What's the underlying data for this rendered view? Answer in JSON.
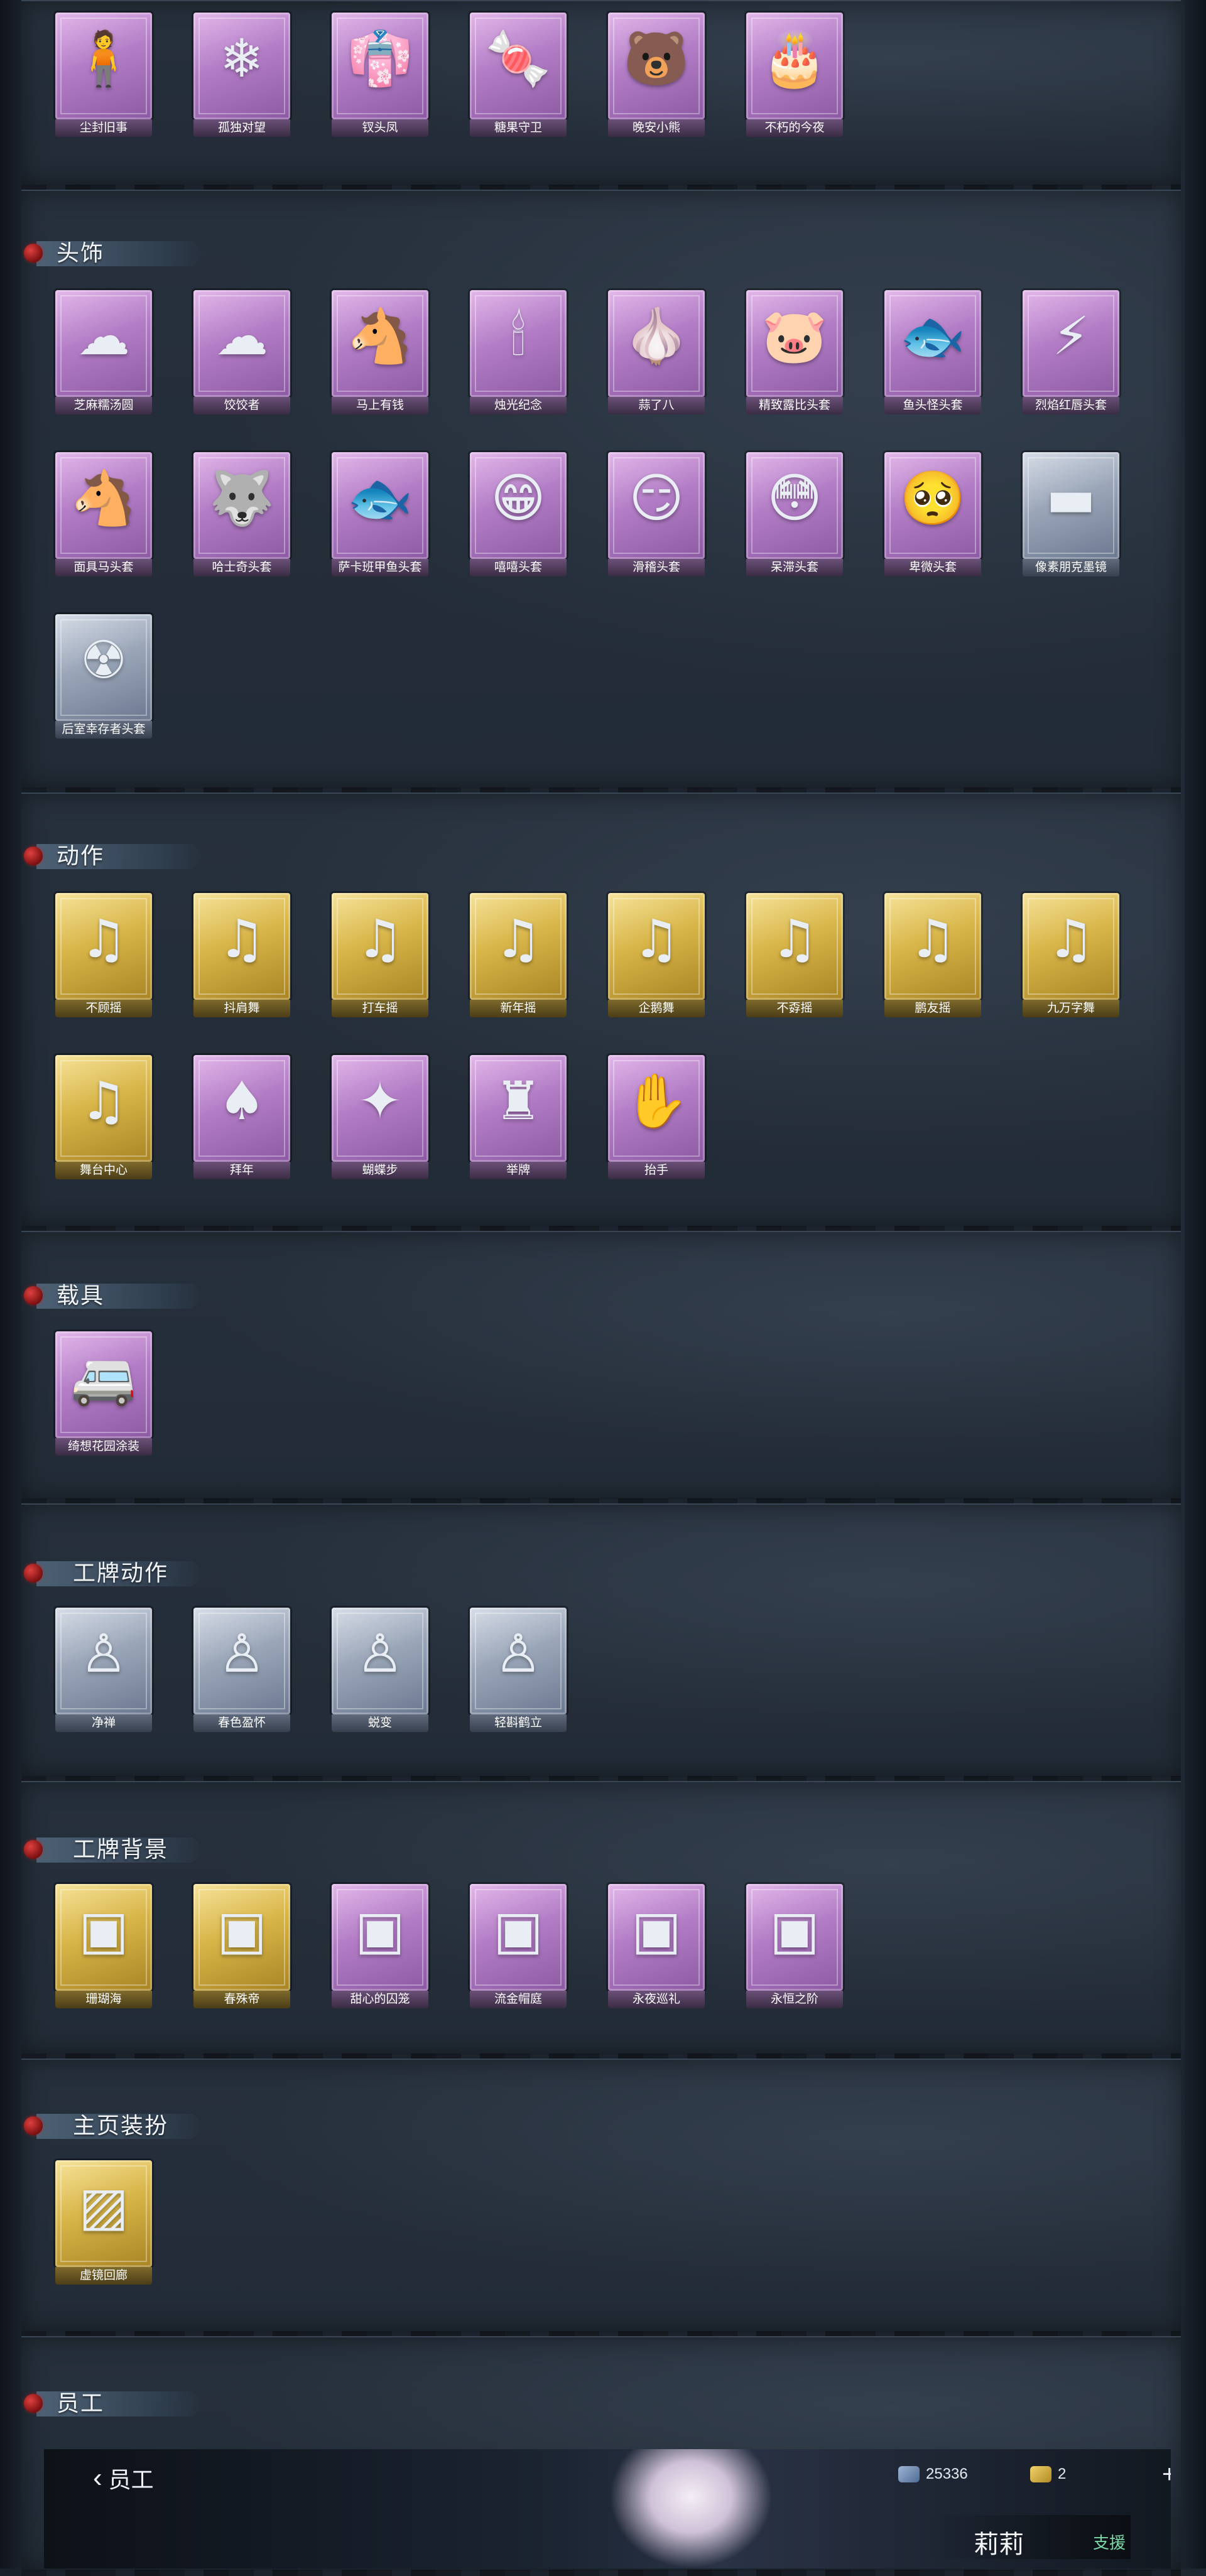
{
  "colors": {
    "panel": "#222b36",
    "rarity_purple": "#b37dc6",
    "rarity_gold": "#d8b548",
    "rarity_silver": "#9aa6b8",
    "header_dot": "#c02a2a"
  },
  "sections": [
    {
      "title": "",
      "items": [
        {
          "label": "尘封旧事",
          "rarity": "purple",
          "icon": "figure-keychain-icon"
        },
        {
          "label": "孤独对望",
          "rarity": "purple",
          "icon": "crystal-keychain-icon"
        },
        {
          "label": "钗头凤",
          "rarity": "purple",
          "icon": "doll-keychain-icon"
        },
        {
          "label": "糖果守卫",
          "rarity": "purple",
          "icon": "candy-guard-keychain-icon"
        },
        {
          "label": "晚安小熊",
          "rarity": "purple",
          "icon": "bear-keychain-icon"
        },
        {
          "label": "不朽的今夜",
          "rarity": "purple",
          "icon": "cake-keychain-icon"
        }
      ]
    },
    {
      "title": "头饰",
      "items": [
        {
          "label": "芝麻糯汤圆",
          "rarity": "purple",
          "icon": "dumpling-hat-icon"
        },
        {
          "label": "饺饺者",
          "rarity": "purple",
          "icon": "cloud-hat-icon"
        },
        {
          "label": "马上有钱",
          "rarity": "purple",
          "icon": "horse-hat-icon"
        },
        {
          "label": "烛光纪念",
          "rarity": "purple",
          "icon": "candle-hat-icon"
        },
        {
          "label": "蒜了八",
          "rarity": "purple",
          "icon": "garlic-hat-icon"
        },
        {
          "label": "精致露比头套",
          "rarity": "purple",
          "icon": "pink-mask-icon"
        },
        {
          "label": "鱼头怪头套",
          "rarity": "purple",
          "icon": "fish-head-icon"
        },
        {
          "label": "烈焰红唇头套",
          "rarity": "purple",
          "icon": "yellow-mascot-icon"
        },
        {
          "label": "面具马头套",
          "rarity": "purple",
          "icon": "horse-mask-icon"
        },
        {
          "label": "哈士奇头套",
          "rarity": "purple",
          "icon": "husky-mask-icon"
        },
        {
          "label": "萨卡班甲鱼头套",
          "rarity": "purple",
          "icon": "fish-mask-icon"
        },
        {
          "label": "嘻嘻头套",
          "rarity": "purple",
          "icon": "grin-emoji-icon"
        },
        {
          "label": "滑稽头套",
          "rarity": "purple",
          "icon": "funny-emoji-icon"
        },
        {
          "label": "呆滞头套",
          "rarity": "purple",
          "icon": "dazed-emoji-icon"
        },
        {
          "label": "卑微头套",
          "rarity": "purple",
          "icon": "humble-emoji-icon"
        },
        {
          "label": "像素朋克墨镜",
          "rarity": "silver",
          "icon": "pixel-sunglasses-icon"
        },
        {
          "label": "后室幸存者头套",
          "rarity": "silver",
          "icon": "gas-mask-icon"
        }
      ]
    },
    {
      "title": "动作",
      "items": [
        {
          "label": "不顾摇",
          "rarity": "gold",
          "icon": "dance-pose-icon"
        },
        {
          "label": "抖肩舞",
          "rarity": "gold",
          "icon": "dance-pose-icon"
        },
        {
          "label": "打车摇",
          "rarity": "gold",
          "icon": "dance-pose-icon"
        },
        {
          "label": "新年摇",
          "rarity": "gold",
          "icon": "dance-pose-icon"
        },
        {
          "label": "企鹅舞",
          "rarity": "gold",
          "icon": "dance-pose-icon"
        },
        {
          "label": "不孬摇",
          "rarity": "gold",
          "icon": "dance-pose-icon"
        },
        {
          "label": "鹏友摇",
          "rarity": "gold",
          "icon": "dance-pose-icon"
        },
        {
          "label": "九万字舞",
          "rarity": "gold",
          "icon": "dance-pose-icon"
        },
        {
          "label": "舞台中心",
          "rarity": "gold",
          "icon": "dance-pose-icon"
        },
        {
          "label": "拜年",
          "rarity": "purple",
          "icon": "bow-pose-icon"
        },
        {
          "label": "蝴蝶步",
          "rarity": "purple",
          "icon": "butterfly-pose-icon"
        },
        {
          "label": "举牌",
          "rarity": "purple",
          "icon": "sign-pose-icon"
        },
        {
          "label": "抬手",
          "rarity": "purple",
          "icon": "raise-hand-pose-icon"
        }
      ]
    },
    {
      "title": "载具",
      "items": [
        {
          "label": "绮想花园涂装",
          "rarity": "purple",
          "icon": "van-icon"
        }
      ]
    },
    {
      "title": "工牌动作",
      "items": [
        {
          "label": "净禅",
          "rarity": "silver",
          "icon": "badge-pose-icon"
        },
        {
          "label": "春色盈怀",
          "rarity": "silver",
          "icon": "badge-pose-icon"
        },
        {
          "label": "蜕变",
          "rarity": "silver",
          "icon": "badge-pose-icon"
        },
        {
          "label": "轻斟鹤立",
          "rarity": "silver",
          "icon": "badge-pose-icon"
        }
      ]
    },
    {
      "title": "工牌背景",
      "items": [
        {
          "label": "珊瑚海",
          "rarity": "gold",
          "icon": "card-background-icon"
        },
        {
          "label": "春殊帝",
          "rarity": "gold",
          "icon": "card-background-icon"
        },
        {
          "label": "甜心的囚笼",
          "rarity": "purple",
          "icon": "card-background-icon"
        },
        {
          "label": "流金帽庭",
          "rarity": "purple",
          "icon": "card-background-icon"
        },
        {
          "label": "永夜巡礼",
          "rarity": "purple",
          "icon": "card-background-icon"
        },
        {
          "label": "永恒之阶",
          "rarity": "purple",
          "icon": "card-background-icon"
        }
      ]
    },
    {
      "title": "主页装扮",
      "items": [
        {
          "label": "虚镜回廊",
          "rarity": "gold",
          "icon": "homepage-frame-icon"
        }
      ]
    },
    {
      "title": "员工",
      "items": []
    }
  ],
  "staff_preview": {
    "back_label": "员工",
    "currency1": "25336",
    "currency2": "2",
    "plus": "+",
    "name": "莉莉",
    "role": "支援"
  }
}
